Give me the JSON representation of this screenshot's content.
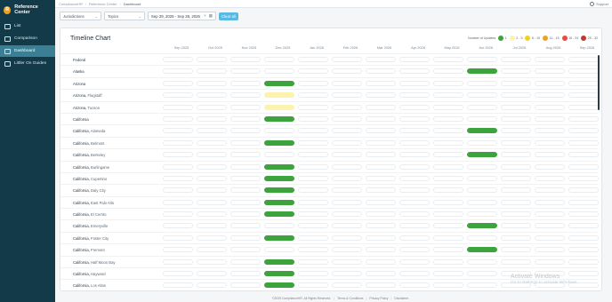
{
  "sidebar": {
    "brand": "Reference Center",
    "brand_logo": "R",
    "items": [
      {
        "label": "List",
        "icon": "list-icon",
        "active": false
      },
      {
        "label": "Comparison",
        "icon": "comparison-icon",
        "active": false
      },
      {
        "label": "Dashboard",
        "icon": "dashboard-icon",
        "active": true
      },
      {
        "label": "Littler On Guides",
        "icon": "guides-icon",
        "active": false
      }
    ]
  },
  "topbar": {
    "crumbs": [
      "ComplianceHR",
      "Reference Center",
      "Dashboard"
    ],
    "support": "Support"
  },
  "filters": {
    "jurisdictions": "Jurisdictions",
    "topics": "Topics",
    "date_range": "Sep 29, 2025 - Sep 28, 2026",
    "clear_all": "Clear all"
  },
  "chart": {
    "title": "Timeline Chart",
    "legend_title": "Number of Updates",
    "legend": [
      {
        "label": "1",
        "color": "#3da33d"
      },
      {
        "label": "2 - 5",
        "color": "#fdf3b0"
      },
      {
        "label": "6 - 10",
        "color": "#f5d020"
      },
      {
        "label": "11 - 15",
        "color": "#f0a020"
      },
      {
        "label": "16 - 24",
        "color": "#e84c3d"
      },
      {
        "label": "25 - 32",
        "color": "#c0392b"
      }
    ],
    "months": [
      "Sep 2025",
      "Oct 2025",
      "Nov 2025",
      "Dec 2025",
      "Jan 2026",
      "Feb 2026",
      "Mar 2026",
      "Apr 2026",
      "May 2026",
      "Jun 2026",
      "Jul 2026",
      "Aug 2026",
      "Sep 2026"
    ],
    "rows": [
      {
        "name": "Federal",
        "sub": "",
        "levels": [
          0,
          0,
          0,
          0,
          0,
          0,
          0,
          0,
          0,
          0,
          0,
          0,
          0
        ]
      },
      {
        "name": "Alaska",
        "sub": "",
        "levels": [
          0,
          0,
          0,
          0,
          0,
          0,
          0,
          0,
          0,
          1,
          0,
          0,
          0
        ]
      },
      {
        "name": "Arizona",
        "sub": "",
        "levels": [
          0,
          0,
          0,
          1,
          0,
          0,
          0,
          0,
          0,
          0,
          0,
          0,
          0
        ]
      },
      {
        "name": "Arizona,",
        "sub": "Flagstaff",
        "levels": [
          0,
          0,
          0,
          2,
          0,
          0,
          0,
          0,
          0,
          0,
          0,
          0,
          0
        ]
      },
      {
        "name": "Arizona,",
        "sub": "Tucson",
        "levels": [
          0,
          0,
          0,
          2,
          0,
          0,
          0,
          0,
          0,
          0,
          0,
          0,
          0
        ]
      },
      {
        "name": "California",
        "sub": "",
        "levels": [
          0,
          0,
          0,
          1,
          0,
          0,
          0,
          0,
          0,
          0,
          0,
          0,
          0
        ]
      },
      {
        "name": "California,",
        "sub": "Alameda",
        "levels": [
          0,
          0,
          0,
          0,
          0,
          0,
          0,
          0,
          0,
          1,
          0,
          0,
          0
        ]
      },
      {
        "name": "California,",
        "sub": "Belmont",
        "levels": [
          0,
          0,
          0,
          1,
          0,
          0,
          0,
          0,
          0,
          0,
          0,
          0,
          0
        ]
      },
      {
        "name": "California,",
        "sub": "Berkeley",
        "levels": [
          0,
          0,
          0,
          0,
          0,
          0,
          0,
          0,
          0,
          1,
          0,
          0,
          0
        ]
      },
      {
        "name": "California,",
        "sub": "Burlingame",
        "levels": [
          0,
          0,
          0,
          1,
          0,
          0,
          0,
          0,
          0,
          0,
          0,
          0,
          0
        ]
      },
      {
        "name": "California,",
        "sub": "Cupertino",
        "levels": [
          0,
          0,
          0,
          1,
          0,
          0,
          0,
          0,
          0,
          0,
          0,
          0,
          0
        ]
      },
      {
        "name": "California,",
        "sub": "Daly City",
        "levels": [
          0,
          0,
          0,
          1,
          0,
          0,
          0,
          0,
          0,
          0,
          0,
          0,
          0
        ]
      },
      {
        "name": "California,",
        "sub": "East Palo Alto",
        "levels": [
          0,
          0,
          0,
          1,
          0,
          0,
          0,
          0,
          0,
          0,
          0,
          0,
          0
        ]
      },
      {
        "name": "California,",
        "sub": "El Cerrito",
        "levels": [
          0,
          0,
          0,
          1,
          0,
          0,
          0,
          0,
          0,
          0,
          0,
          0,
          0
        ]
      },
      {
        "name": "California,",
        "sub": "Emeryville",
        "levels": [
          0,
          0,
          0,
          0,
          0,
          0,
          0,
          0,
          0,
          1,
          0,
          0,
          0
        ]
      },
      {
        "name": "California,",
        "sub": "Foster City",
        "levels": [
          0,
          0,
          0,
          1,
          0,
          0,
          0,
          0,
          0,
          0,
          0,
          0,
          0
        ]
      },
      {
        "name": "California,",
        "sub": "Fremont",
        "levels": [
          0,
          0,
          0,
          0,
          0,
          0,
          0,
          0,
          0,
          1,
          0,
          0,
          0
        ]
      },
      {
        "name": "California,",
        "sub": "Half Moon Bay",
        "levels": [
          0,
          0,
          0,
          1,
          0,
          0,
          0,
          0,
          0,
          0,
          0,
          0,
          0
        ]
      },
      {
        "name": "California,",
        "sub": "Hayward",
        "levels": [
          0,
          0,
          0,
          1,
          0,
          0,
          0,
          0,
          0,
          0,
          0,
          0,
          0
        ]
      },
      {
        "name": "California,",
        "sub": "Los Altos",
        "levels": [
          0,
          0,
          0,
          1,
          0,
          0,
          0,
          0,
          0,
          0,
          0,
          0,
          0
        ]
      }
    ]
  },
  "watermark": {
    "line1": "Activate Windows",
    "line2": "Go to Settings to activate Windows."
  },
  "footer": {
    "copyright": "©2025 ComplianceHR. All Rights Reserved.",
    "terms": "Terms & Conditions",
    "privacy": "Privacy Policy",
    "disclaimer": "Disclaimer"
  }
}
